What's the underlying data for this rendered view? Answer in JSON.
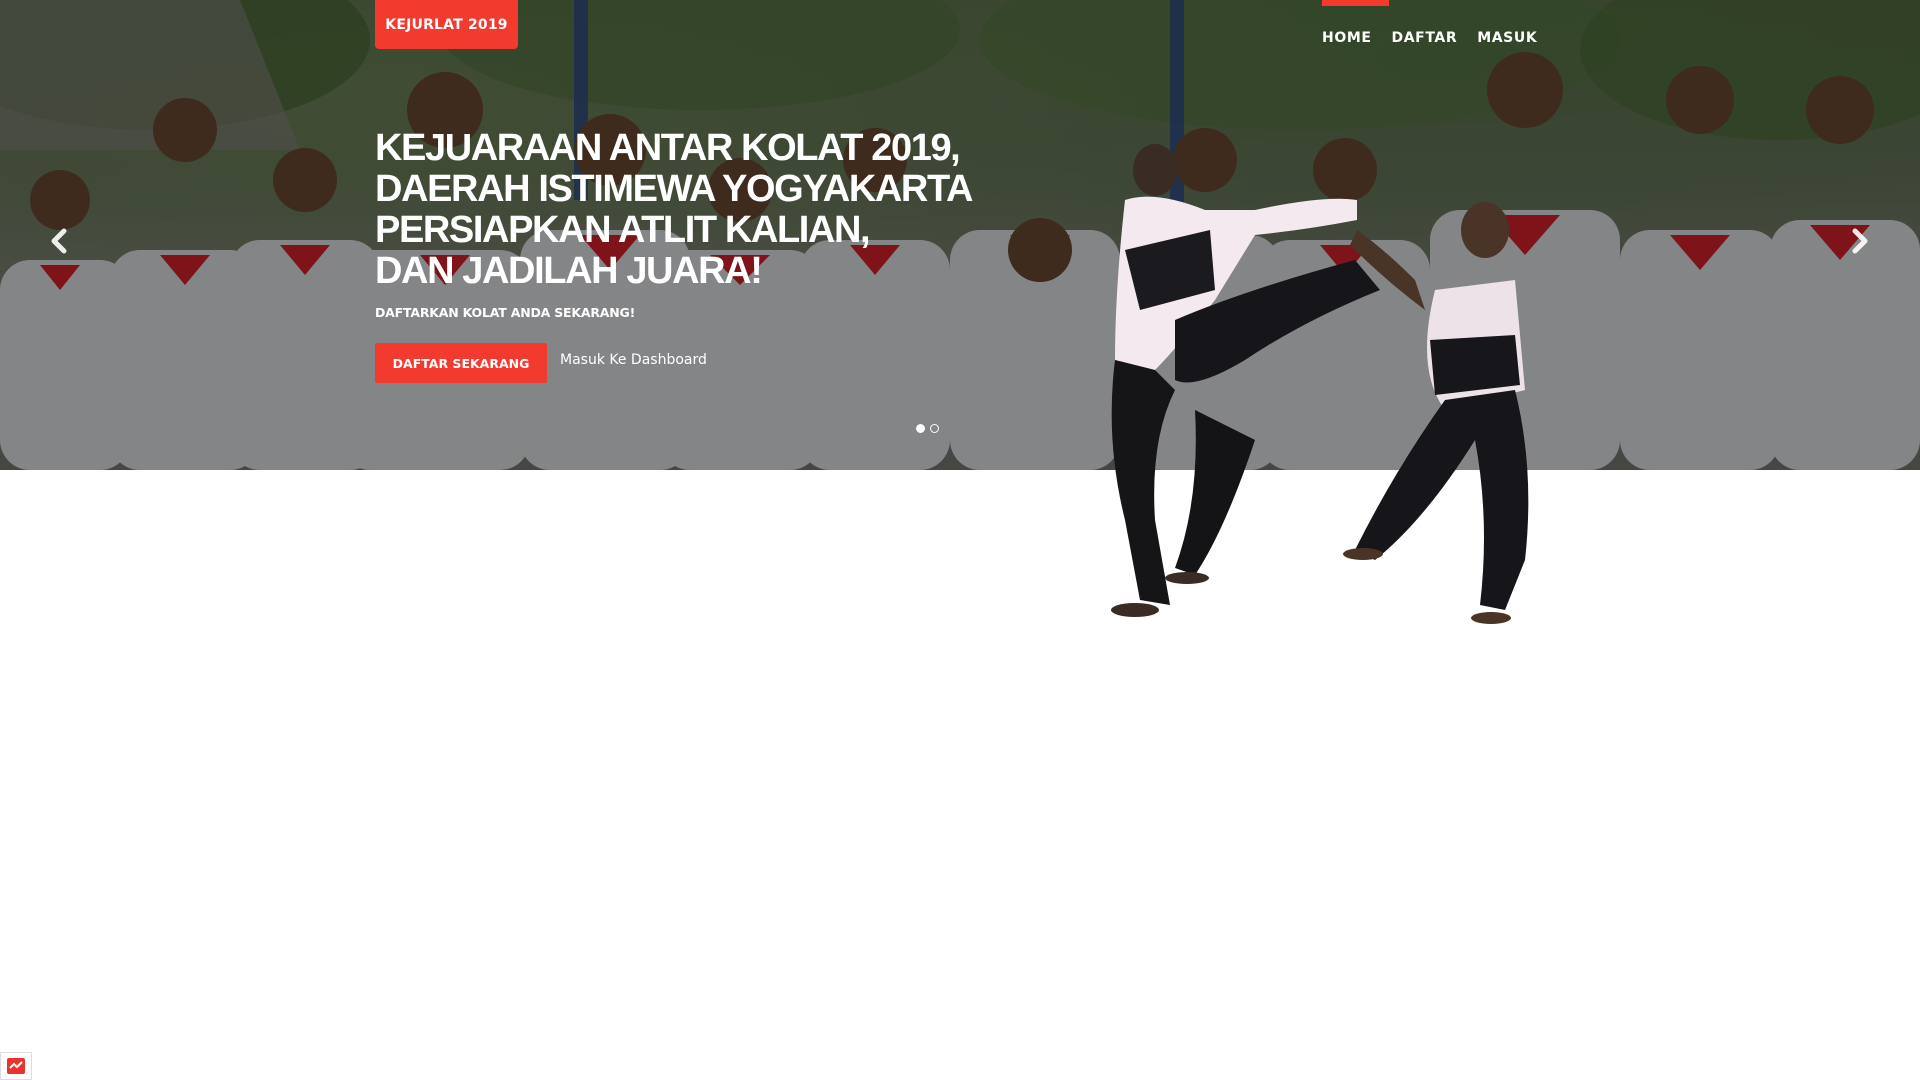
{
  "brand": {
    "label": "KEJURLAT 2019"
  },
  "nav": {
    "items": [
      {
        "label": "HOME"
      },
      {
        "label": "DAFTAR"
      },
      {
        "label": "MASUK"
      }
    ]
  },
  "hero": {
    "headline": [
      "KEJUARAAN ANTAR KOLAT 2019,",
      "DAERAH ISTIMEWA YOGYAKARTA",
      "PERSIAPKAN ATLIT KALIAN,",
      "DAN JADILAH JUARA!"
    ],
    "subhead": "DAFTARKAN KOLAT ANDA SEKARANG!",
    "cta_label": "DAFTAR SEKARANG",
    "secondary_label": "Masuk Ke Dashboard",
    "slides": {
      "count": 2,
      "active": 1
    }
  },
  "icons": {
    "prev": "chevron-left-icon",
    "next": "chevron-right-icon",
    "footer": "app-logo-icon"
  },
  "colors": {
    "accent": "#f23a2e",
    "text_on_dark": "#ffffff",
    "page_background": "#ffffff"
  }
}
